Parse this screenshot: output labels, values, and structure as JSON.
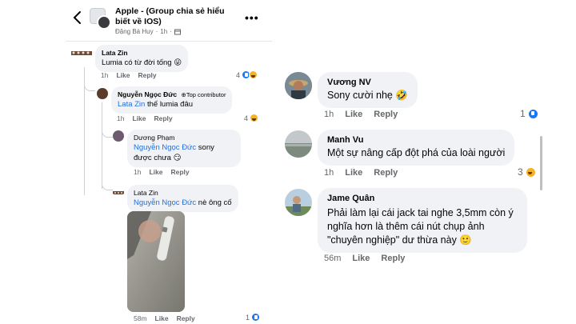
{
  "header": {
    "title": "Apple - (Group chia sẻ hiểu biết về IOS)",
    "author": "Đặng Bá Huy",
    "time": "1h",
    "back_icon": "chevron-left-icon",
    "more_icon": "more-dots-icon",
    "more_label": "•••"
  },
  "left_comments": [
    {
      "name": "Lata Zin",
      "text": "Lumia có từ đời tống",
      "emoji": "😜",
      "time": "1h",
      "like": "Like",
      "reply": "Reply",
      "reaction_count": "4"
    },
    {
      "name": "Nguyễn Ngọc Đức",
      "badge": "Top contributor",
      "mention": "Lata Zin",
      "text": " thế lumia đâu",
      "time": "1h",
      "like": "Like",
      "reply": "Reply",
      "reaction_count": "4"
    },
    {
      "name": "Dương Phạm",
      "mention": "Nguyễn Ngọc Đức",
      "text": " sony được chưa",
      "emoji": "😏",
      "time": "1h",
      "like": "Like",
      "reply": "Reply"
    },
    {
      "name": "Lata Zin",
      "mention": "Nguyễn Ngọc Đức",
      "text": " nè ông cố",
      "time": "58m",
      "like": "Like",
      "reply": "Reply",
      "reaction_count": "1"
    }
  ],
  "right_comments": [
    {
      "name": "Vương NV",
      "text": "Sony cười nhẹ",
      "emoji": "🤣",
      "time": "1h",
      "like": "Like",
      "reply": "Reply",
      "reaction_count": "1"
    },
    {
      "name": "Manh Vu",
      "text": "Một sự nâng cấp đột phá của loài người",
      "time": "1h",
      "like": "Like",
      "reply": "Reply",
      "reaction_count": "3"
    },
    {
      "name": "Jame Quân",
      "text_lines": [
        "Phải làm lại cái jack tai nghe 3,5mm còn ý",
        "nghĩa hơn là thêm cái nút chụp ảnh",
        "\"chuyên nghiệp\" dư thừa này"
      ],
      "emoji": "🙂",
      "time": "56m",
      "like": "Like",
      "reply": "Reply"
    }
  ],
  "colors": {
    "link": "#216fdb",
    "bubble": "#f0f2f5",
    "meta": "#65676b",
    "like_blue": "#1877f2",
    "haha_yellow": "#f7b125"
  }
}
